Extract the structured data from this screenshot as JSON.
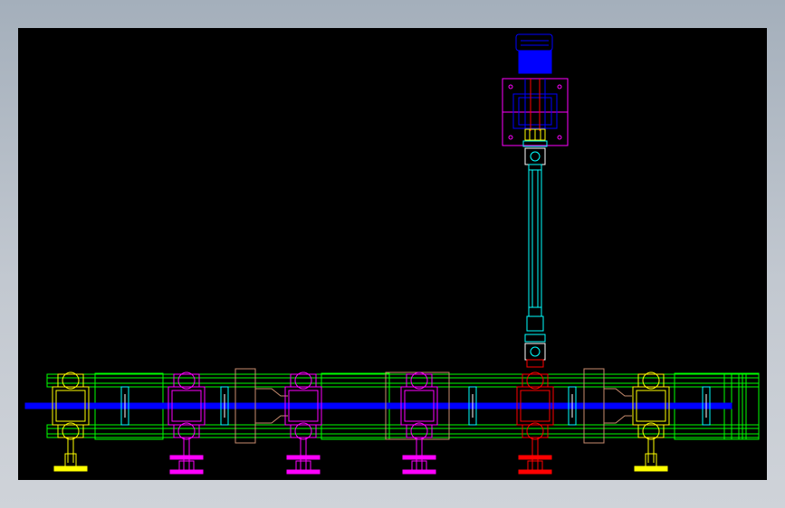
{
  "viewer": {
    "background_outer": "#b8c0ca",
    "background_canvas": "#000000"
  },
  "colors": {
    "frame": "#00ff00",
    "shaft": "#0000ff",
    "roller_yellow": "#ffff00",
    "roller_magenta": "#ff00ff",
    "roller_red": "#ff0000",
    "cyan": "#00ffff",
    "tan": "#c88c6e",
    "motor": "#0000ff"
  },
  "icons": {
    "motor": "drive-motor-icon",
    "gearbox": "gearbox-icon",
    "driveshaft": "drive-shaft-icon"
  },
  "drawing": {
    "roller_units": [
      {
        "name": "roller-unit-1",
        "color": "yellow"
      },
      {
        "name": "roller-unit-2",
        "color": "magenta"
      },
      {
        "name": "roller-unit-3",
        "color": "magenta"
      },
      {
        "name": "roller-unit-4",
        "color": "magenta"
      },
      {
        "name": "roller-unit-5-driven",
        "color": "red"
      },
      {
        "name": "roller-unit-6",
        "color": "yellow"
      }
    ]
  }
}
